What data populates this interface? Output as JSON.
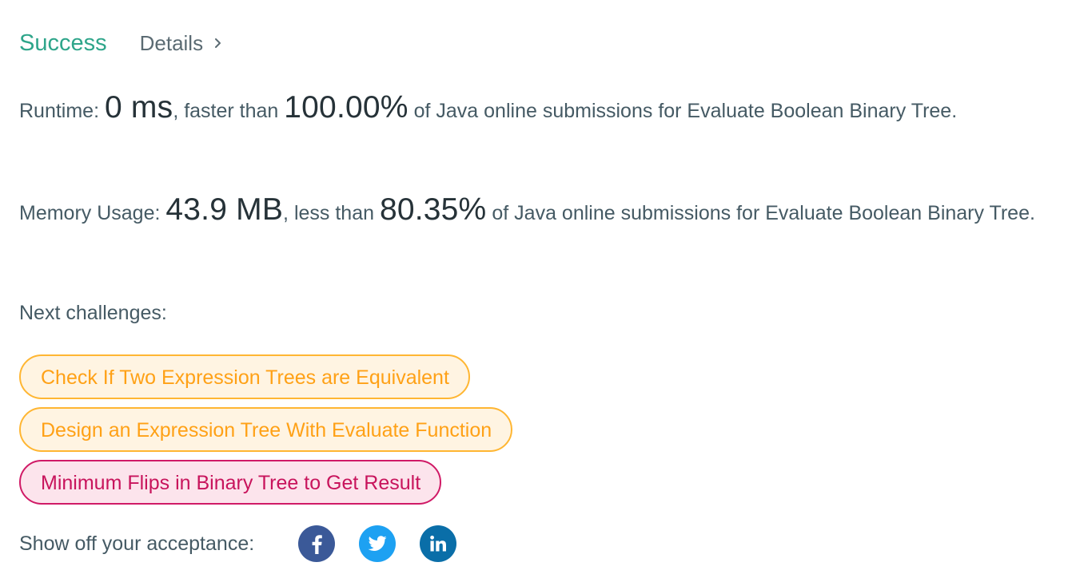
{
  "header": {
    "status": "Success",
    "details_label": "Details"
  },
  "runtime": {
    "label": "Runtime: ",
    "value": "0 ms",
    "comparison": ", faster than ",
    "percent": "100.00%",
    "suffix": " of Java online submissions for Evaluate Boolean Binary Tree."
  },
  "memory": {
    "label": "Memory Usage: ",
    "value": "43.9 MB",
    "comparison": ", less than ",
    "percent": "80.35%",
    "suffix": " of Java online submissions for Evaluate Boolean Binary Tree."
  },
  "next": {
    "label": "Next challenges:",
    "items": [
      {
        "title": "Check If Two Expression Trees are Equivalent",
        "difficulty": "medium"
      },
      {
        "title": "Design an Expression Tree With Evaluate Function",
        "difficulty": "medium"
      },
      {
        "title": "Minimum Flips in Binary Tree to Get Result",
        "difficulty": "hard"
      }
    ]
  },
  "share": {
    "label": "Show off your acceptance:",
    "icons": [
      "facebook-icon",
      "twitter-icon",
      "linkedin-icon"
    ]
  },
  "colors": {
    "success": "#2ea58a",
    "medium": "#ffa116",
    "hard": "#c8145c",
    "facebook": "#3b5998",
    "twitter": "#1da1f2",
    "linkedin": "#0a6ea8"
  }
}
